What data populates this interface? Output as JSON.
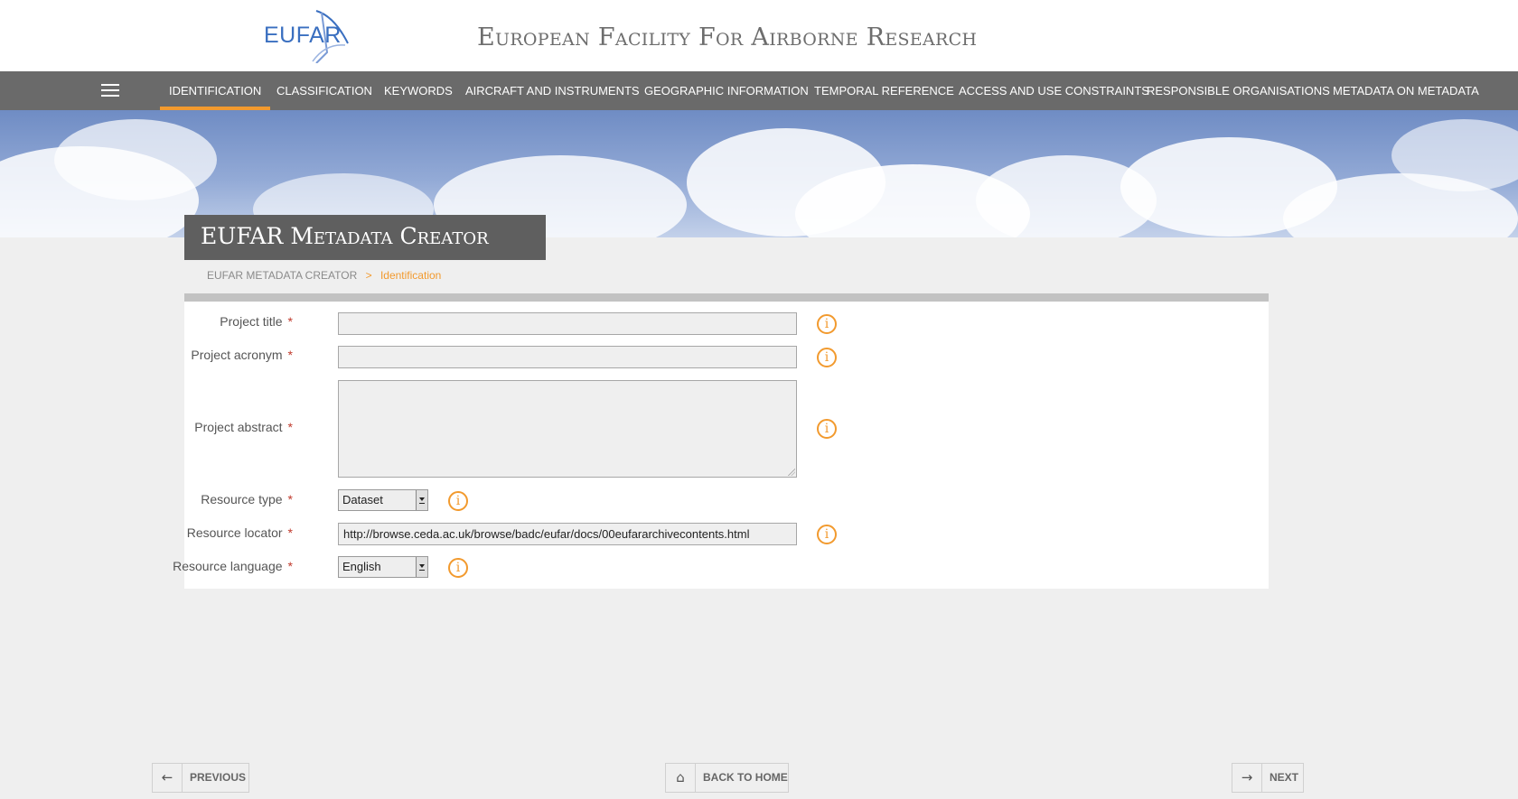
{
  "header": {
    "logo_text": "EUFAR",
    "site_title": "European Facility For Airborne Research"
  },
  "nav": {
    "items": [
      {
        "label": "Identification",
        "active": true
      },
      {
        "label": "Classification"
      },
      {
        "label": "Keywords"
      },
      {
        "label": "Aircraft and Instruments"
      },
      {
        "label": "Geographic Information"
      },
      {
        "label": "Temporal Reference"
      },
      {
        "label": "Access and Use Constraints"
      },
      {
        "label": "Responsible Organisations"
      },
      {
        "label": "Metadata on Metadata"
      }
    ]
  },
  "page": {
    "title": "EUFAR Metadata Creator",
    "breadcrumb_root": "EUFAR Metadata Creator",
    "breadcrumb_sep": ">",
    "breadcrumb_current": "Identification"
  },
  "form": {
    "required_mark": "*",
    "info_glyph": "i",
    "project_title": {
      "label": "Project title",
      "value": ""
    },
    "project_acronym": {
      "label": "Project acronym",
      "value": ""
    },
    "project_abstract": {
      "label": "Project abstract",
      "value": ""
    },
    "resource_type": {
      "label": "Resource type",
      "value": "Dataset"
    },
    "resource_locator": {
      "label": "Resource locator",
      "value": "http://browse.ceda.ac.uk/browse/badc/eufar/docs/00eufararchivecontents.html"
    },
    "resource_language": {
      "label": "Resource language",
      "value": "English"
    }
  },
  "footer": {
    "previous_label": "Previous",
    "home_label": "Back to Home",
    "next_label": "Next"
  },
  "colors": {
    "accent": "#f29a2e",
    "nav_bg": "#6a6a6a",
    "required": "#c0392b"
  },
  "icons": {
    "menu": "hamburger-icon",
    "info": "info-icon",
    "previous": "arrow-left-icon",
    "home": "home-icon",
    "next": "arrow-right-icon"
  }
}
